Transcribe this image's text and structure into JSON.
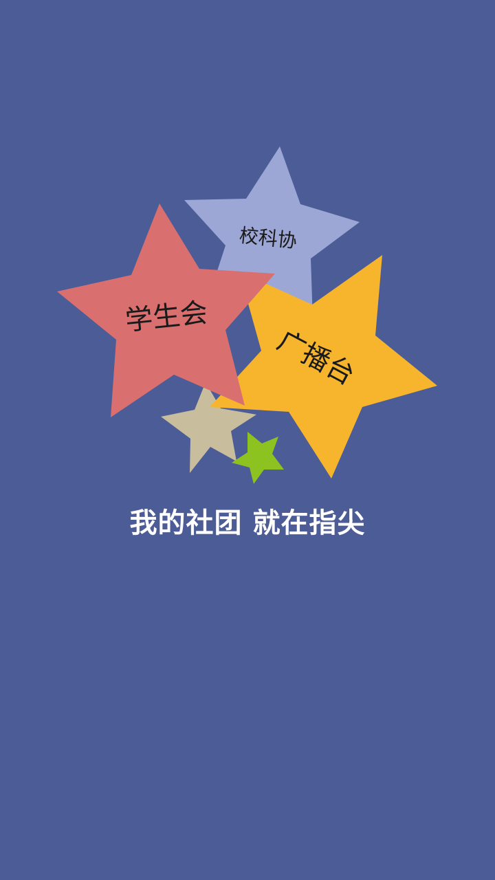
{
  "splash": {
    "slogan": "我的社团 就在指尖",
    "stars": [
      {
        "id": "kexie",
        "label": "校科协",
        "color": "#9ca7d6",
        "icon": "star-shape"
      },
      {
        "id": "xueshenghui",
        "label": "学生会",
        "color": "#d9706f",
        "icon": "star-shape"
      },
      {
        "id": "guangbotai",
        "label": "广播台",
        "color": "#f7b52e",
        "icon": "star-shape"
      },
      {
        "id": "beige",
        "label": "",
        "color": "#c8bd9c",
        "icon": "star-shape"
      },
      {
        "id": "green",
        "label": "",
        "color": "#8dc320",
        "icon": "star-shape"
      }
    ],
    "background_color": "#4c5c96",
    "slogan_color": "#ffffff"
  }
}
